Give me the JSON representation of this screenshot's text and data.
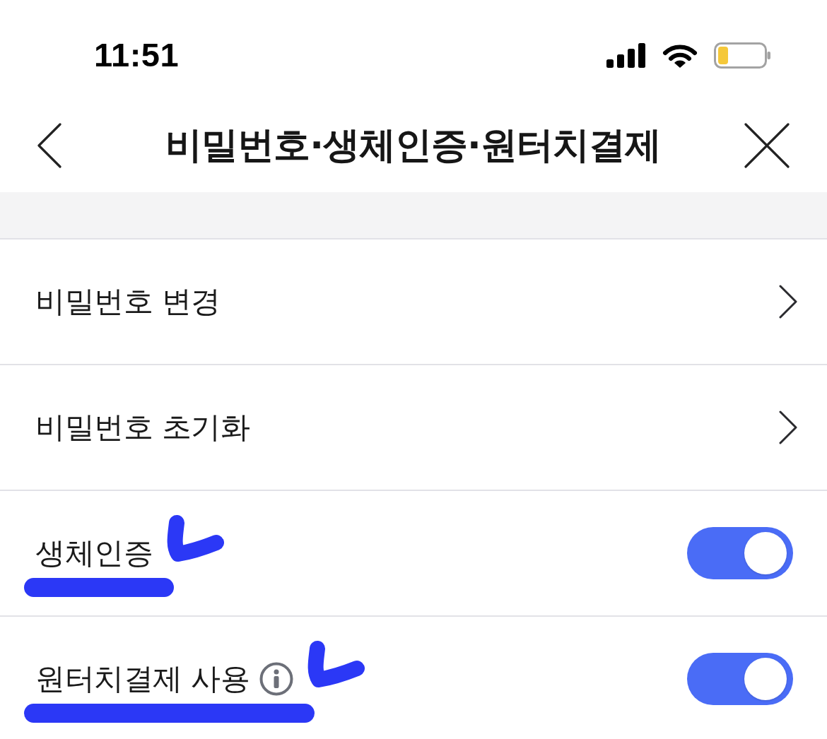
{
  "status_bar": {
    "time": "11:51"
  },
  "header": {
    "title": "비밀번호·생체인증·원터치결제"
  },
  "rows": [
    {
      "kind": "link",
      "label": "비밀번호 변경"
    },
    {
      "kind": "link",
      "label": "비밀번호 초기화"
    },
    {
      "kind": "toggle",
      "label": "생체인증",
      "on": true,
      "marked": true
    },
    {
      "kind": "toggle",
      "label": "원터치결제 사용",
      "on": true,
      "info": true,
      "marked": true
    }
  ]
}
